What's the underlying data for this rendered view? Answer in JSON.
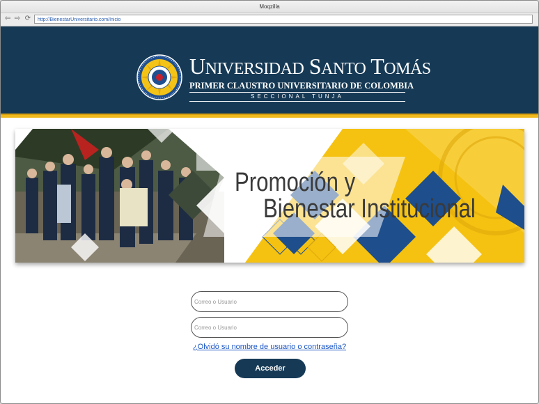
{
  "browser": {
    "title": "Moqzilla",
    "url": "http://BienestarUniversitario.com/Inicio",
    "back_icon": "back-arrow-icon",
    "forward_icon": "forward-arrow-icon",
    "reload_icon": "reload-icon"
  },
  "header": {
    "brand_u": "U",
    "brand_niversidad": "NIVERSIDAD",
    "brand_s": "S",
    "brand_anto": "ANTO",
    "brand_t": "T",
    "brand_omas": "OMÁS",
    "subtitle": "PRIMER CLAUSTRO UNIVERSITARIO DE COLOMBIA",
    "seccional": "SECCIONAL TUNJA",
    "background_color": "#163a56",
    "stripe_color": "#f1b91b"
  },
  "banner": {
    "line1": "Promoción y",
    "line2": "Bienestar Institucional"
  },
  "login": {
    "user_placeholder": "Correo o Usuario",
    "password_placeholder": "Correo o Usuario",
    "forgot_link": "¿Olvidó su nombre de usuario o contraseña?",
    "submit_label": "Acceder"
  }
}
